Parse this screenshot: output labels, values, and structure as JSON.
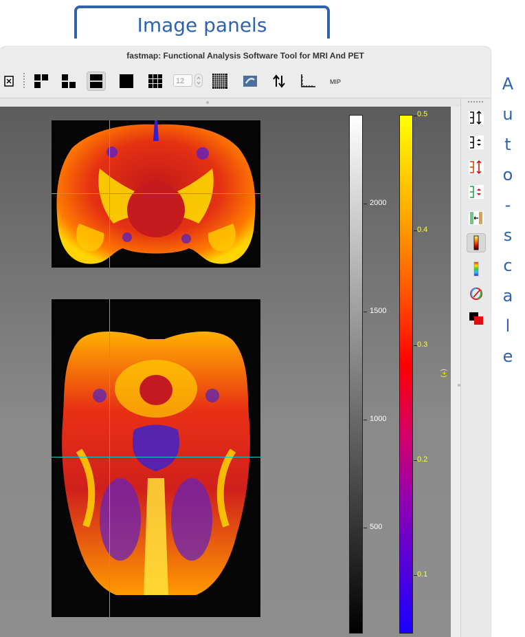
{
  "annotations": {
    "image_panels_label": "Image panels",
    "autoscale_letters": [
      "A",
      "u",
      "t",
      "o",
      "-",
      "s",
      "c",
      "a",
      "l",
      "e"
    ],
    "accent_color": "#2f62ad"
  },
  "window": {
    "title": "fastmap: Functional Analysis Software Tool for MRI And PET"
  },
  "toolbar": {
    "buttons": [
      {
        "name": "close-all",
        "icon": "x-box-icon"
      },
      {
        "name": "layout-4-panels",
        "icon": "four-panel-layout-icon"
      },
      {
        "name": "layout-3-panels",
        "icon": "three-panel-layout-icon"
      },
      {
        "name": "layout-2-panels",
        "icon": "two-panel-layout-icon",
        "selected": true
      },
      {
        "name": "layout-1-panel",
        "icon": "single-panel-layout-icon"
      },
      {
        "name": "layout-grid",
        "icon": "grid-layout-icon"
      },
      {
        "name": "mosaic",
        "icon": "mosaic-grid-icon"
      },
      {
        "name": "link",
        "icon": "link-icon"
      },
      {
        "name": "flip",
        "icon": "up-down-arrows-icon"
      },
      {
        "name": "axes",
        "icon": "axes-icon"
      }
    ],
    "slice_count_value": "12",
    "mip_label": "MIP"
  },
  "grayscale_colorbar": {
    "labels": [
      "2000",
      "1500",
      "1000",
      "500"
    ],
    "values": [
      2000,
      1500,
      1000,
      500
    ]
  },
  "hot_colorbar": {
    "labels": [
      "0.5",
      "0.4",
      "0.3",
      "0.2",
      "0.1"
    ],
    "values": [
      0.5,
      0.4,
      0.3,
      0.2,
      0.1
    ],
    "unit_label": "(+)",
    "label_color": "#ffff33"
  },
  "side_tools": [
    {
      "icon": "autoscale-range-icon"
    },
    {
      "icon": "autoscale-step-icon"
    },
    {
      "icon": "autoscale-overlay-range-icon"
    },
    {
      "icon": "autoscale-overlay-step-icon"
    },
    {
      "icon": "colorbar-position-icon"
    },
    {
      "icon": "hot-colormap-icon",
      "selected": true
    },
    {
      "icon": "rainbow-colormap-icon"
    },
    {
      "icon": "colormap-wheel-icon"
    },
    {
      "icon": "overlay-blend-icon"
    }
  ]
}
